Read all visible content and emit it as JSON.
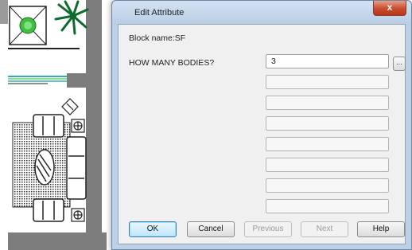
{
  "dialog": {
    "title": "Edit Attribute",
    "close_label": "x",
    "block_name": "Block name:SF",
    "attributes": [
      {
        "prompt": "HOW MANY BODIES?",
        "value": "3"
      }
    ],
    "browse_label": "...",
    "buttons": {
      "ok": "OK",
      "cancel": "Cancel",
      "previous": "Previous",
      "next": "Next",
      "help": "Help"
    }
  },
  "colors": {
    "title_bar": "#c5d7ec",
    "close_button": "#c94b2c",
    "dialog_client": "#f0f0f0",
    "default_button_border": "#3c7fb1"
  }
}
